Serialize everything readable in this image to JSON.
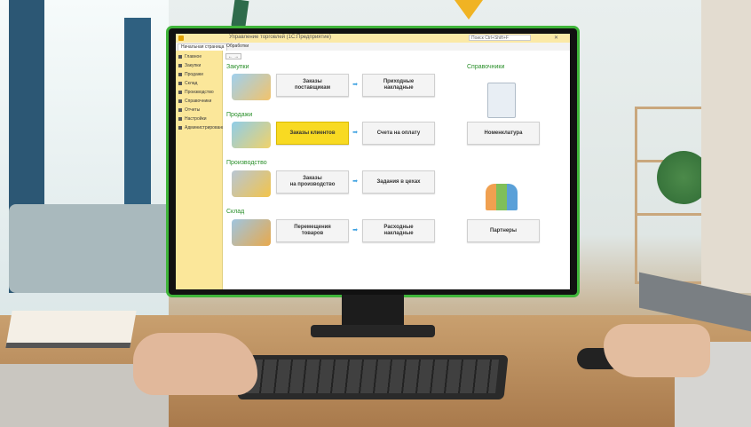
{
  "window": {
    "title": "Управление торговлей (1С:Предприятие)",
    "search_placeholder": "Поиск Ctrl+Shift+F"
  },
  "tabs": [
    {
      "label": "Начальная страница",
      "active": true
    },
    {
      "label": "Обработки",
      "active": false
    }
  ],
  "sidebar": {
    "items": [
      {
        "label": "Главное",
        "icon": "menu-icon"
      },
      {
        "label": "Закупки",
        "icon": "cart-icon"
      },
      {
        "label": "Продажи",
        "icon": "sales-icon"
      },
      {
        "label": "Склад",
        "icon": "warehouse-icon"
      },
      {
        "label": "Производство",
        "icon": "factory-icon"
      },
      {
        "label": "Справочники",
        "icon": "book-icon"
      },
      {
        "label": "Отчеты",
        "icon": "report-icon"
      },
      {
        "label": "Настройки",
        "icon": "gear-icon"
      },
      {
        "label": "Администрирование",
        "icon": "admin-icon"
      }
    ]
  },
  "content": {
    "back_label": "← →",
    "sections": {
      "purchases": "Закупки",
      "sales": "Продажи",
      "production": "Производство",
      "warehouse": "Склад",
      "references": "Справочники"
    },
    "buttons": {
      "supplier_orders": "Заказы\nпоставщикам",
      "incoming_invoices": "Приходные\nнакладные",
      "client_orders": "Заказы клиентов",
      "payment_invoices": "Счета на оплату",
      "production_orders": "Заказы\nна производство",
      "shop_tasks": "Задания в цехах",
      "goods_transfers": "Перемещения\nтоваров",
      "outgoing_invoices": "Расходные\nнакладные",
      "nomenclature": "Номенклатура",
      "partners": "Партнеры"
    },
    "flow_arrow": "➡"
  },
  "colors": {
    "sidebar": "#fbe79a",
    "section_title": "#2a8f2a",
    "highlight_button": "#f8da22",
    "screen_border": "#3fb53a",
    "arrow_flow": "#3aa0e0"
  }
}
